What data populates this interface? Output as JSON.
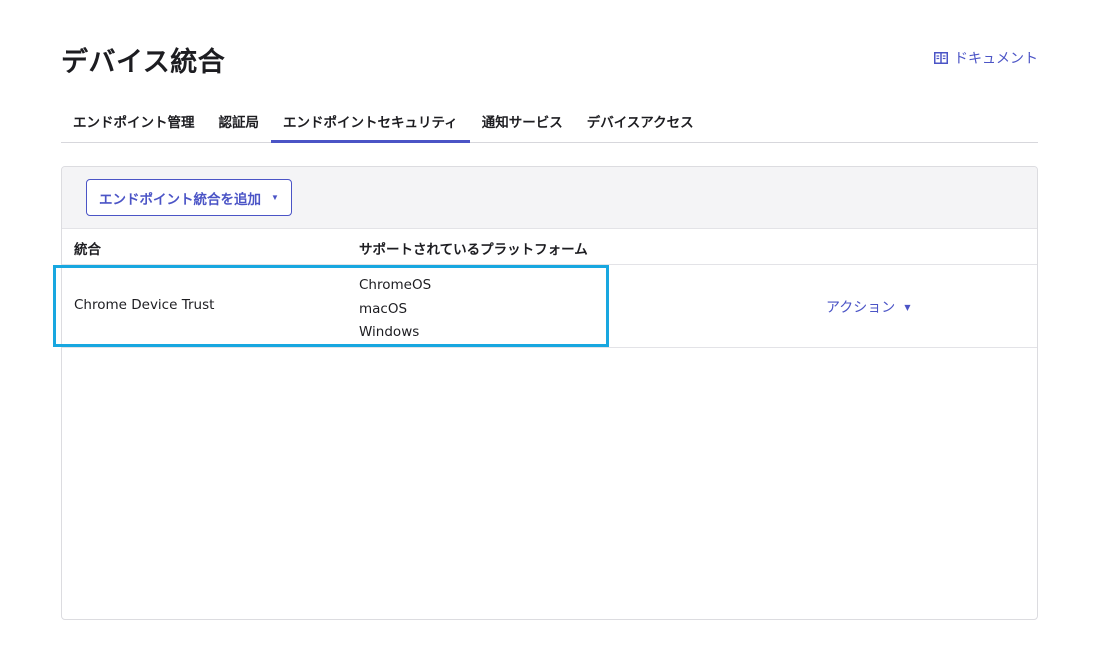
{
  "header": {
    "title": "デバイス統合",
    "docs_label": "ドキュメント",
    "docs_icon": "book-icon"
  },
  "tabs": [
    {
      "label": "エンドポイント管理",
      "active": false
    },
    {
      "label": "認証局",
      "active": false
    },
    {
      "label": "エンドポイントセキュリティ",
      "active": true
    },
    {
      "label": "通知サービス",
      "active": false
    },
    {
      "label": "デバイスアクセス",
      "active": false
    }
  ],
  "toolbar": {
    "add_label": "エンドポイント統合を追加",
    "add_icon": "caret-down-icon"
  },
  "table": {
    "columns": [
      "統合",
      "サポートされているプラットフォーム"
    ],
    "rows": [
      {
        "integration": "Chrome Device Trust",
        "platforms": [
          "ChromeOS",
          "macOS",
          "Windows"
        ],
        "action_label": "アクション"
      }
    ]
  },
  "colors": {
    "accent": "#4b54c6",
    "highlight": "#18a7e0"
  }
}
